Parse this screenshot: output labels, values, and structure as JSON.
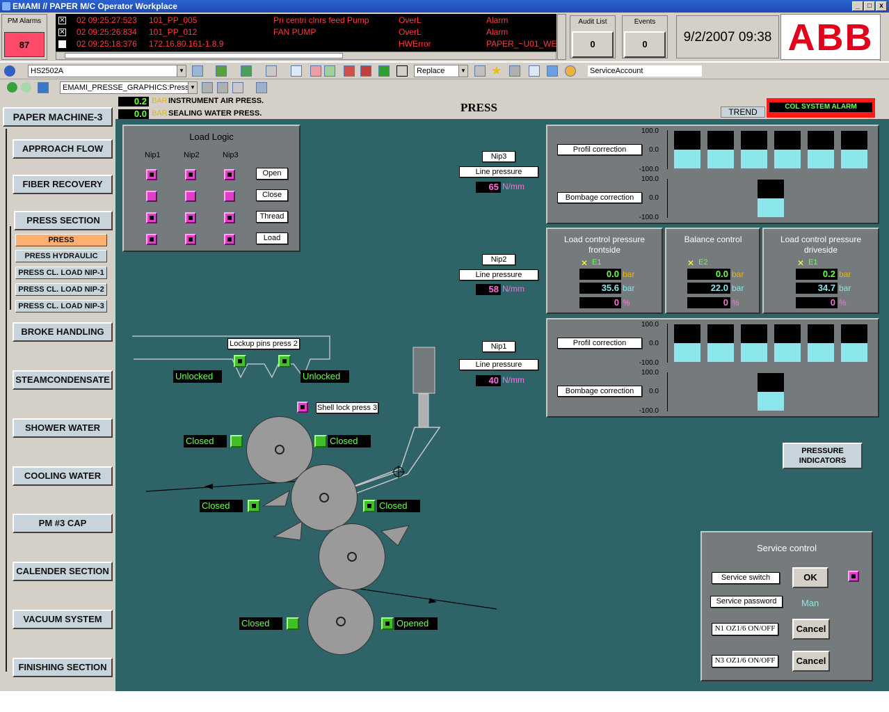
{
  "window": {
    "title": "EMAMI // PAPER M/C Operator Workplace",
    "buttons": [
      "_",
      "□",
      "x"
    ]
  },
  "alarm_header": {
    "pm_alarms_label": "PM Alarms",
    "pm_alarms_count": "87",
    "rows": [
      {
        "checked": true,
        "time": "02 09:25:27:523",
        "tag": "101_PP_005",
        "desc": "Pri centri clnrs feed Pump",
        "cond": "OverL",
        "type": "Alarm"
      },
      {
        "checked": true,
        "time": "02 09:25:26:834",
        "tag": "101_PP_012",
        "desc": "FAN PUMP",
        "cond": "OverL",
        "type": "Alarm"
      },
      {
        "checked": false,
        "time": "02 09:25:18:376",
        "tag": "172.16.80.161-1.8.9",
        "desc": "",
        "cond": "HWError",
        "type": "PAPER_~U01_WE"
      }
    ],
    "audit_list_label": "Audit List",
    "audit_list_count": "0",
    "events_label": "Events",
    "events_count": "0",
    "datetime": "9/2/2007 09:38",
    "logo": "ABB"
  },
  "toolbar1": {
    "object_combo": "HS2502A",
    "mode_combo": "Replace",
    "account": "ServiceAccount"
  },
  "toolbar2": {
    "display_combo": "EMAMI_PRESSE_GRAPHICS:Press"
  },
  "nav": {
    "header": "PAPER MACHINE-3",
    "items": [
      {
        "label": "APPROACH FLOW"
      },
      {
        "label": "FIBER RECOVERY"
      },
      {
        "label": "PRESS SECTION"
      },
      {
        "label": "BROKE HANDLING"
      },
      {
        "label": "STEAMCONDENSATE"
      },
      {
        "label": "SHOWER WATER"
      },
      {
        "label": "COOLING WATER"
      },
      {
        "label": "PM #3 CAP"
      },
      {
        "label": "CALENDER SECTION"
      },
      {
        "label": "VACUUM SYSTEM"
      },
      {
        "label": "FINISHING SECTION"
      }
    ],
    "sub_items": [
      {
        "label": "PRESS",
        "active": true
      },
      {
        "label": "PRESS HYDRAULIC"
      },
      {
        "label": "PRESS CL. LOAD NIP-1"
      },
      {
        "label": "PRESS CL. LOAD NIP-2"
      },
      {
        "label": "PRESS CL. LOAD NIP-3"
      }
    ]
  },
  "top_info": {
    "instrument_air": {
      "value": "0.2",
      "unit": "BAR",
      "label": "INSTRUMENT AIR PRESS."
    },
    "sealing_water": {
      "value": "0.0",
      "unit": "BAR",
      "label": "SEALING WATER PRESS."
    },
    "page_title": "PRESS",
    "trend_button": "TREND",
    "alarm_button": "COL SYSTEM ALARM"
  },
  "load_logic": {
    "title": "Load Logic",
    "columns": [
      "Nip1",
      "Nip2",
      "Nip3"
    ],
    "buttons": [
      "Open",
      "Close",
      "Thread",
      "Load"
    ]
  },
  "nips": [
    {
      "name": "Nip3",
      "line_pressure_label": "Line pressure",
      "value": "65",
      "unit": "N/mm"
    },
    {
      "name": "Nip2",
      "line_pressure_label": "Line pressure",
      "value": "58",
      "unit": "N/mm"
    },
    {
      "name": "Nip1",
      "line_pressure_label": "Line pressure",
      "value": "40",
      "unit": "N/mm"
    }
  ],
  "profile_panels": [
    {
      "profil_label": "Profil correction",
      "bombage_label": "Bombage correction",
      "ticks": [
        "100.0",
        "0.0",
        "-100.0",
        "100.0",
        "0.0",
        "-100.0"
      ]
    },
    {
      "profil_label": "Profil correction",
      "bombage_label": "Bombage correction",
      "ticks": [
        "100.0",
        "0.0",
        "-100.0",
        "100.0",
        "0.0",
        "-100.0"
      ]
    }
  ],
  "control_panels": [
    {
      "title": "Load control pressure frontside",
      "tag": "E1",
      "v1": "0.0",
      "u1": "bar",
      "v2": "35.6",
      "u2": "bar",
      "v3": "0",
      "u3": "%"
    },
    {
      "title": "Balance control",
      "tag": "E2",
      "v1": "0.0",
      "u1": "bar",
      "v2": "22.0",
      "u2": "bar",
      "v3": "0",
      "u3": "%"
    },
    {
      "title": "Load control pressure driveside",
      "tag": "E1",
      "v1": "0.2",
      "u1": "bar",
      "v2": "34.7",
      "u2": "bar",
      "v3": "0",
      "u3": "%"
    }
  ],
  "diagram": {
    "lockup_label": "Lockup pins press 2",
    "unlocked_left": "Unlocked",
    "unlocked_right": "Unlocked",
    "shell_lock": "Shell lock press 3",
    "status": {
      "r1_left": "Closed",
      "r1_right": "Closed",
      "r2_left": "Closed",
      "r2_right": "Closed",
      "r4_left": "Closed",
      "r4_right": "Opened"
    }
  },
  "pressure_indicators": "PRESSURE INDICATORS",
  "service": {
    "title": "Service control",
    "service_switch": "Service switch",
    "ok": "OK",
    "service_password": "Service password",
    "mode": "Man",
    "n1": "N1 OZ1/6 ON/OFF",
    "n3": "N3 OZ1/6 ON/OFF",
    "cancel": "Cancel"
  },
  "colors": {
    "background": "#2e6468",
    "panel": "#757a7c",
    "value_green": "#6cff4a",
    "unit_magenta": "#ff6ee0",
    "alarm_red": "#ff3b3b"
  }
}
